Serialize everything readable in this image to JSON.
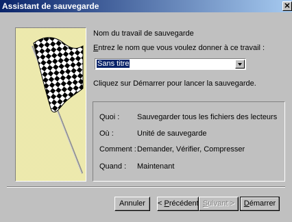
{
  "window": {
    "title": "Assistant de sauvegarde",
    "close_glyph": "✕"
  },
  "job": {
    "heading": "Nom du travail de sauvegarde",
    "prompt_first": "E",
    "prompt_rest": "ntrez le nom que vous voulez donner à ce travail :",
    "name_value": "Sans titre",
    "hint": "Cliquez sur Démarrer pour lancer la sauvegarde."
  },
  "summary": {
    "rows": [
      {
        "label": "Quoi :",
        "value": "Sauvegarder tous les fichiers des lecteurs"
      },
      {
        "label": "Où :",
        "value": "Unité de sauvegarde"
      },
      {
        "label": "Comment :",
        "value": "Demander, Vérifier, Compresser"
      },
      {
        "label": "Quand :",
        "value": "Maintenant"
      }
    ]
  },
  "buttons": {
    "cancel": "Annuler",
    "prev_prefix": "< ",
    "prev_mnemonic": "P",
    "prev_rest": "récédent",
    "next_mnemonic": "S",
    "next_rest": "uivant >",
    "start_mnemonic": "D",
    "start_rest": "émarrer"
  },
  "icons": {
    "flag": "checkered-flag-icon",
    "dropdown": "chevron-down-icon",
    "close": "close-icon"
  },
  "colors": {
    "titlebar_start": "#0a246a",
    "titlebar_end": "#a6caf0",
    "selection": "#0a246a",
    "dialog_face": "#c0c0c0",
    "flag_panel": "#f4f0b8"
  }
}
